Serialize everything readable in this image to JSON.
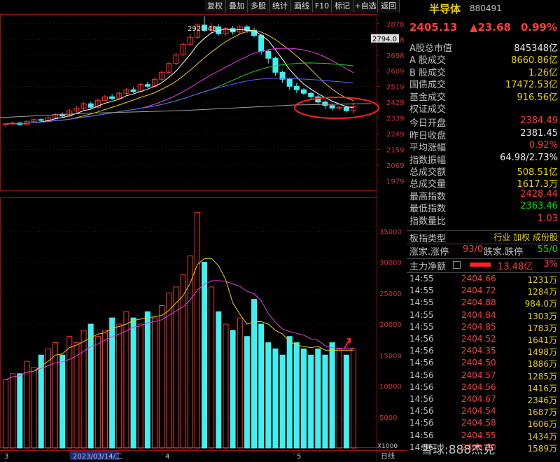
{
  "toolbar": [
    "复权",
    "叠加",
    "多股",
    "统计",
    "画线",
    "F10",
    "标记",
    "+自选",
    "返回"
  ],
  "panel": {
    "title": "半导体",
    "code": "880491",
    "price": "2405.13",
    "change": "▲23.68",
    "pct": "0.99%",
    "rows": [
      {
        "label": "A股总市值",
        "value": "845348亿",
        "cls": "wht"
      },
      {
        "label": "A 股成交",
        "value": "8660.86亿",
        "cls": "yel"
      },
      {
        "label": "B 股成交",
        "value": "1.26亿",
        "cls": "yel"
      },
      {
        "label": "国债成交",
        "value": "17472.53亿",
        "cls": "yel"
      },
      {
        "label": "基金成交",
        "value": "916.56亿",
        "cls": "yel"
      },
      {
        "label": "权证成交",
        "value": "",
        "cls": "yel"
      },
      {
        "label": "今日开盘",
        "value": "2384.49",
        "cls": "red"
      },
      {
        "label": "昨日收盘",
        "value": "2381.45",
        "cls": "wht"
      },
      {
        "label": "平均涨幅",
        "value": "0.92%",
        "cls": "red"
      },
      {
        "label": "指数振幅",
        "value": "64.98/2.73%",
        "cls": "wht"
      },
      {
        "label": "总成交额",
        "value": "508.51亿",
        "cls": "yel"
      },
      {
        "label": "总成交量",
        "value": "1617.3万",
        "cls": "yel"
      },
      {
        "label": "最高指数",
        "value": "2428.44",
        "cls": "red"
      },
      {
        "label": "最低指数",
        "value": "2363.46",
        "cls": "grn"
      },
      {
        "label": "指数量比",
        "value": "1.03",
        "cls": "red"
      }
    ],
    "bkt_label": "板指类型",
    "bkt_values": "行业 加权 成份股",
    "zd_label": "涨家.涨停",
    "zd_up": "93/0",
    "zd_down_label": "跌家.跌停",
    "zd_down": "55/0",
    "main_label": "主力净额",
    "main_value": "13.48亿",
    "main_pct": "3%",
    "ticks": [
      {
        "t": "14:55",
        "p": "2404.66",
        "v": "1231万"
      },
      {
        "t": "14:55",
        "p": "2404.72",
        "v": "1284万"
      },
      {
        "t": "14:55",
        "p": "2404.88",
        "v": "984.0万"
      },
      {
        "t": "14:55",
        "p": "2404.84",
        "v": "1303万"
      },
      {
        "t": "14:55",
        "p": "2404.85",
        "v": "1783万"
      },
      {
        "t": "14:56",
        "p": "2404.52",
        "v": "1641万"
      },
      {
        "t": "14:56",
        "p": "2404.35",
        "v": "1498万"
      },
      {
        "t": "14:56",
        "p": "2404.50",
        "v": "1886万"
      },
      {
        "t": "14:56",
        "p": "2404.57",
        "v": "1285万"
      },
      {
        "t": "14:56",
        "p": "2404.56",
        "v": "1416万"
      },
      {
        "t": "14:56",
        "p": "2404.67",
        "v": "2346万"
      },
      {
        "t": "14:56",
        "p": "2404.54",
        "v": "1687万"
      },
      {
        "t": "14:56",
        "p": "2404.58",
        "v": "1606万"
      },
      {
        "t": "14:56",
        "p": "2404.55",
        "v": "1434万"
      },
      {
        "t": "14:56",
        "p": "2405.00",
        "v": "1589万"
      }
    ]
  },
  "chart_data": {
    "type": "candlestick",
    "price_ticks": [
      "2878",
      "2788",
      "2698",
      "2609",
      "2519",
      "2429",
      "2339",
      "2249",
      "2159",
      "2069",
      "1979"
    ],
    "price_range": [
      1925,
      2925
    ],
    "current_label": "2794.0",
    "high_label": "2920.48",
    "vol_ticks": [
      "35000",
      "30000",
      "25000",
      "20000",
      "15000",
      "10000",
      "5000"
    ],
    "vol_range": [
      0,
      40000
    ],
    "vol_unit": "X1000",
    "date_labels": [
      "3",
      "2023/03/14/二",
      "4",
      "5"
    ],
    "period_label": "日线",
    "candles": [
      [
        2300,
        2305,
        2290,
        2310
      ],
      [
        2305,
        2310,
        2295,
        2320
      ],
      [
        2310,
        2300,
        2295,
        2318
      ],
      [
        2300,
        2320,
        2295,
        2325
      ],
      [
        2320,
        2330,
        2310,
        2340
      ],
      [
        2330,
        2325,
        2315,
        2340
      ],
      [
        2325,
        2340,
        2320,
        2348
      ],
      [
        2340,
        2360,
        2330,
        2368
      ],
      [
        2360,
        2350,
        2340,
        2370
      ],
      [
        2350,
        2380,
        2345,
        2390
      ],
      [
        2380,
        2395,
        2370,
        2410
      ],
      [
        2395,
        2420,
        2385,
        2430
      ],
      [
        2420,
        2400,
        2390,
        2432
      ],
      [
        2400,
        2440,
        2395,
        2450
      ],
      [
        2440,
        2460,
        2430,
        2470
      ],
      [
        2460,
        2450,
        2440,
        2475
      ],
      [
        2450,
        2480,
        2445,
        2490
      ],
      [
        2480,
        2500,
        2470,
        2510
      ],
      [
        2500,
        2490,
        2480,
        2515
      ],
      [
        2490,
        2530,
        2485,
        2540
      ],
      [
        2530,
        2520,
        2510,
        2545
      ],
      [
        2520,
        2560,
        2515,
        2570
      ],
      [
        2560,
        2600,
        2550,
        2610
      ],
      [
        2600,
        2650,
        2590,
        2660
      ],
      [
        2650,
        2700,
        2640,
        2710
      ],
      [
        2700,
        2760,
        2690,
        2770
      ],
      [
        2760,
        2800,
        2750,
        2820
      ],
      [
        2800,
        2870,
        2790,
        2880
      ],
      [
        2870,
        2840,
        2830,
        2920
      ],
      [
        2840,
        2860,
        2820,
        2880
      ],
      [
        2860,
        2820,
        2810,
        2875
      ],
      [
        2820,
        2850,
        2810,
        2860
      ],
      [
        2850,
        2830,
        2815,
        2865
      ],
      [
        2830,
        2860,
        2820,
        2870
      ],
      [
        2860,
        2840,
        2825,
        2870
      ],
      [
        2840,
        2810,
        2800,
        2855
      ],
      [
        2810,
        2720,
        2700,
        2820
      ],
      [
        2720,
        2680,
        2650,
        2730
      ],
      [
        2680,
        2600,
        2580,
        2690
      ],
      [
        2600,
        2560,
        2540,
        2610
      ],
      [
        2560,
        2520,
        2500,
        2570
      ],
      [
        2520,
        2500,
        2480,
        2540
      ],
      [
        2500,
        2480,
        2470,
        2510
      ],
      [
        2480,
        2460,
        2440,
        2490
      ],
      [
        2460,
        2430,
        2410,
        2470
      ],
      [
        2430,
        2410,
        2390,
        2440
      ],
      [
        2410,
        2395,
        2380,
        2420
      ],
      [
        2395,
        2400,
        2385,
        2410
      ],
      [
        2400,
        2380,
        2370,
        2410
      ],
      [
        2381,
        2405,
        2363,
        2428
      ]
    ],
    "volumes": [
      11,
      12,
      12,
      14,
      13,
      15,
      16,
      17,
      15,
      18,
      17,
      19,
      20,
      18,
      19,
      21,
      20,
      22,
      21,
      20,
      22,
      21,
      23,
      25,
      26,
      28,
      31,
      38,
      30,
      26,
      22,
      20,
      19,
      21,
      18,
      24,
      20,
      17,
      16,
      15,
      18,
      17,
      16,
      15,
      16,
      15,
      17,
      16,
      15,
      16
    ]
  },
  "watermark": "雪球:888杰克"
}
